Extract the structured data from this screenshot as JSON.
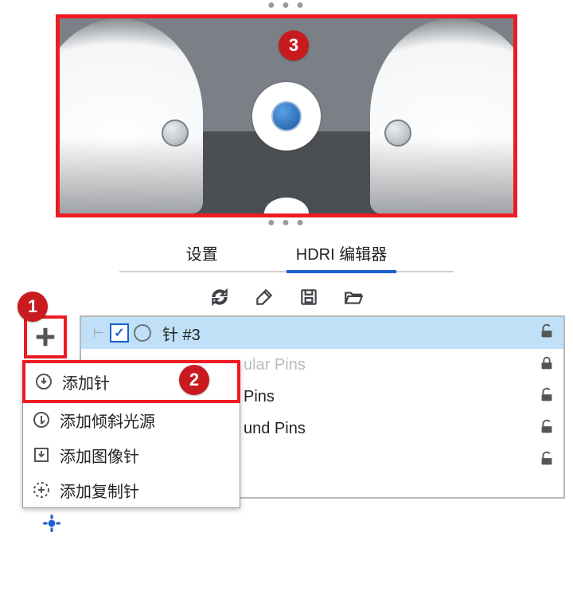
{
  "tabs": {
    "settings": "设置",
    "hdri_editor": "HDRI 编辑器"
  },
  "toolbar": {
    "refresh": "refresh",
    "edit": "edit",
    "save": "save",
    "open": "open"
  },
  "callouts": {
    "one": "1",
    "two": "2",
    "three": "3"
  },
  "pins": {
    "row0": {
      "label": "针 #3",
      "checked": true
    },
    "row1": {
      "label_suffix": "ular Pins"
    },
    "row2": {
      "label_suffix": "Pins"
    },
    "row3": {
      "label_suffix": "und Pins"
    }
  },
  "add_menu": {
    "add_pin": "添加针",
    "add_ramp_light": "添加倾斜光源",
    "add_image_pin": "添加图像针",
    "add_copy_pin": "添加复制针"
  }
}
